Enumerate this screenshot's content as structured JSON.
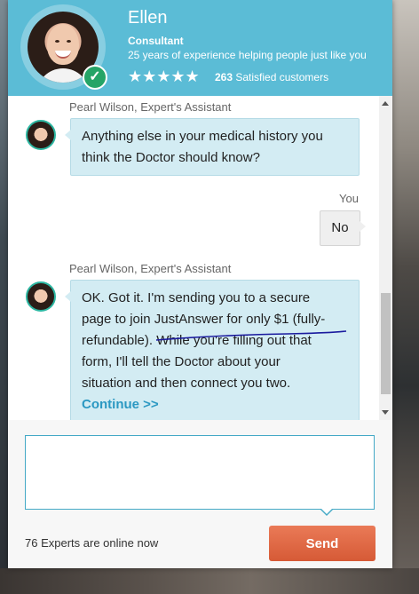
{
  "expert": {
    "name": "Ellen",
    "title": "Consultant",
    "experience": "25 years of experience helping people just like you",
    "stars": "★★★★★",
    "satisfied_count": "263",
    "satisfied_label": "Satisfied customers"
  },
  "messages": [
    {
      "sender": "Pearl Wilson, Expert's Assistant",
      "text_line1": "Anything else in your medical history you",
      "text_line2": "think the Doctor should know?"
    },
    {
      "sender": "You",
      "text": "No"
    },
    {
      "sender": "Pearl Wilson, Expert's Assistant",
      "lines": [
        "OK. Got it. I'm sending you to a secure",
        "page to join JustAnswer for only $1 (fully-",
        "refundable). While you're filling out that",
        "form, I'll tell the Doctor about your",
        "situation and then connect you two."
      ],
      "link": "Continue >>"
    }
  ],
  "composer": {
    "placeholder": "",
    "online_text": "76 Experts are online now",
    "send_label": "Send"
  },
  "colors": {
    "header": "#5bbcd6",
    "bubble": "#d3ecf3",
    "send": "#d65a36",
    "link": "#2b98c2"
  }
}
